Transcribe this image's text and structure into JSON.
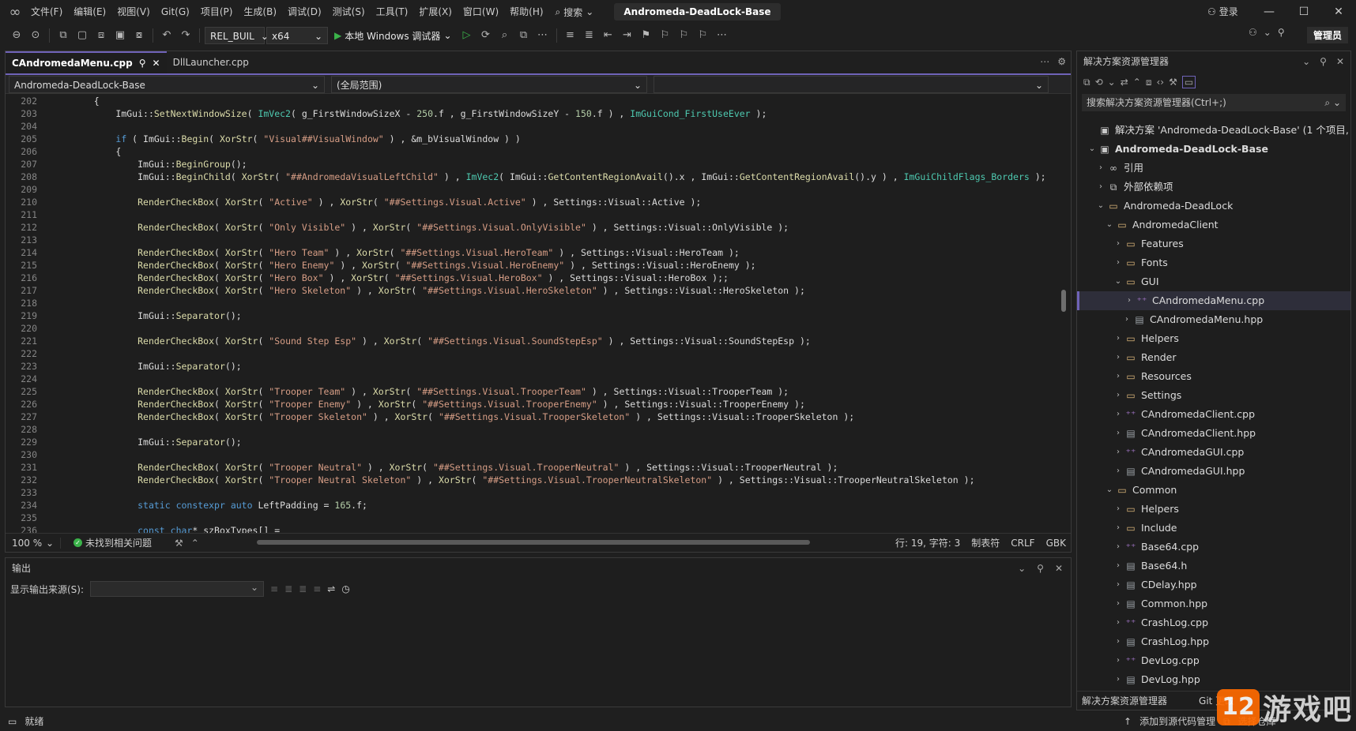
{
  "menubar": {
    "items": [
      "文件(F)",
      "编辑(E)",
      "视图(V)",
      "Git(G)",
      "项目(P)",
      "生成(B)",
      "调试(D)",
      "测试(S)",
      "工具(T)",
      "扩展(X)",
      "窗口(W)",
      "帮助(H)"
    ],
    "search_label": "搜索",
    "solution_name": "Andromeda-DeadLock-Base",
    "login_label": "登录"
  },
  "toolbar": {
    "config": "REL_BUIL",
    "platform": "x64",
    "run_label": "本地 Windows 调试器",
    "admin_label": "管理员"
  },
  "editor": {
    "tabs": [
      {
        "label": "CAndromedaMenu.cpp"
      },
      {
        "label": "DllLauncher.cpp"
      }
    ],
    "nav_project": "Andromeda-DeadLock-Base",
    "nav_scope": "(全局范围)",
    "zoom": "100 %",
    "issues": "未找到相关问题",
    "position": "行: 19, 字符: 3",
    "indent": "制表符",
    "line_ending": "CRLF",
    "encoding": "GBK",
    "lines": [
      {
        "n": "202",
        "c": "    {"
      },
      {
        "n": "203",
        "c": "        ImGui::SetNextWindowSize( ImVec2( g_FirstWindowSizeX - 250.f , g_FirstWindowSizeY - 150.f ) , ImGuiCond_FirstUseEver );"
      },
      {
        "n": "204",
        "c": ""
      },
      {
        "n": "205",
        "c": "        if ( ImGui::Begin( XorStr( \"Visual##VisualWindow\" ) , &m_bVisualWindow ) )"
      },
      {
        "n": "206",
        "c": "        {"
      },
      {
        "n": "207",
        "c": "            ImGui::BeginGroup();"
      },
      {
        "n": "208",
        "c": "            ImGui::BeginChild( XorStr( \"##AndromedaVisualLeftChild\" ) , ImVec2( ImGui::GetContentRegionAvail().x , ImGui::GetContentRegionAvail().y ) , ImGuiChildFlags_Borders );"
      },
      {
        "n": "209",
        "c": ""
      },
      {
        "n": "210",
        "c": "            RenderCheckBox( XorStr( \"Active\" ) , XorStr( \"##Settings.Visual.Active\" ) , Settings::Visual::Active );"
      },
      {
        "n": "211",
        "c": ""
      },
      {
        "n": "212",
        "c": "            RenderCheckBox( XorStr( \"Only Visible\" ) , XorStr( \"##Settings.Visual.OnlyVisible\" ) , Settings::Visual::OnlyVisible );"
      },
      {
        "n": "213",
        "c": ""
      },
      {
        "n": "214",
        "c": "            RenderCheckBox( XorStr( \"Hero Team\" ) , XorStr( \"##Settings.Visual.HeroTeam\" ) , Settings::Visual::HeroTeam );"
      },
      {
        "n": "215",
        "c": "            RenderCheckBox( XorStr( \"Hero Enemy\" ) , XorStr( \"##Settings.Visual.HeroEnemy\" ) , Settings::Visual::HeroEnemy );"
      },
      {
        "n": "216",
        "c": "            RenderCheckBox( XorStr( \"Hero Box\" ) , XorStr( \"##Settings.Visual.HeroBox\" ) , Settings::Visual::HeroBox );;"
      },
      {
        "n": "217",
        "c": "            RenderCheckBox( XorStr( \"Hero Skeleton\" ) , XorStr( \"##Settings.Visual.HeroSkeleton\" ) , Settings::Visual::HeroSkeleton );"
      },
      {
        "n": "218",
        "c": ""
      },
      {
        "n": "219",
        "c": "            ImGui::Separator();"
      },
      {
        "n": "220",
        "c": ""
      },
      {
        "n": "221",
        "c": "            RenderCheckBox( XorStr( \"Sound Step Esp\" ) , XorStr( \"##Settings.Visual.SoundStepEsp\" ) , Settings::Visual::SoundStepEsp );"
      },
      {
        "n": "222",
        "c": ""
      },
      {
        "n": "223",
        "c": "            ImGui::Separator();"
      },
      {
        "n": "224",
        "c": ""
      },
      {
        "n": "225",
        "c": "            RenderCheckBox( XorStr( \"Trooper Team\" ) , XorStr( \"##Settings.Visual.TrooperTeam\" ) , Settings::Visual::TrooperTeam );"
      },
      {
        "n": "226",
        "c": "            RenderCheckBox( XorStr( \"Trooper Enemy\" ) , XorStr( \"##Settings.Visual.TrooperEnemy\" ) , Settings::Visual::TrooperEnemy );"
      },
      {
        "n": "227",
        "c": "            RenderCheckBox( XorStr( \"Trooper Skeleton\" ) , XorStr( \"##Settings.Visual.TrooperSkeleton\" ) , Settings::Visual::TrooperSkeleton );"
      },
      {
        "n": "228",
        "c": ""
      },
      {
        "n": "229",
        "c": "            ImGui::Separator();"
      },
      {
        "n": "230",
        "c": ""
      },
      {
        "n": "231",
        "c": "            RenderCheckBox( XorStr( \"Trooper Neutral\" ) , XorStr( \"##Settings.Visual.TrooperNeutral\" ) , Settings::Visual::TrooperNeutral );"
      },
      {
        "n": "232",
        "c": "            RenderCheckBox( XorStr( \"Trooper Neutral Skeleton\" ) , XorStr( \"##Settings.Visual.TrooperNeutralSkeleton\" ) , Settings::Visual::TrooperNeutralSkeleton );"
      },
      {
        "n": "233",
        "c": ""
      },
      {
        "n": "234",
        "c": "            static constexpr auto LeftPadding = 165.f;"
      },
      {
        "n": "235",
        "c": ""
      },
      {
        "n": "236",
        "c": "            const char* szBoxTypes[] ="
      }
    ]
  },
  "output": {
    "title": "输出",
    "source_label": "显示输出来源(S):"
  },
  "solution": {
    "title": "解决方案资源管理器",
    "search_placeholder": "搜索解决方案资源管理器(Ctrl+;)",
    "footer_tab1": "解决方案资源管理器",
    "footer_tab2": "Git 更改",
    "tree": [
      {
        "label": "解决方案 'Andromeda-DeadLock-Base' (1 个项目,",
        "level": 0,
        "icon": "solution-icon",
        "caret": ""
      },
      {
        "label": "Andromeda-DeadLock-Base",
        "level": 0,
        "icon": "project-icon",
        "caret": "v",
        "bold": true
      },
      {
        "label": "引用",
        "level": 1,
        "icon": "references-icon",
        "caret": ">"
      },
      {
        "label": "外部依赖项",
        "level": 1,
        "icon": "external-deps-icon",
        "caret": ">"
      },
      {
        "label": "Andromeda-DeadLock",
        "level": 1,
        "icon": "folder-icon",
        "caret": "v"
      },
      {
        "label": "AndromedaClient",
        "level": 2,
        "icon": "folder-icon",
        "caret": "v"
      },
      {
        "label": "Features",
        "level": 3,
        "icon": "folder-icon",
        "caret": ">"
      },
      {
        "label": "Fonts",
        "level": 3,
        "icon": "folder-icon",
        "caret": ">"
      },
      {
        "label": "GUI",
        "level": 3,
        "icon": "folder-icon",
        "caret": "v"
      },
      {
        "label": "CAndromedaMenu.cpp",
        "level": 4,
        "icon": "cpp-file-icon",
        "caret": ">",
        "selected": true
      },
      {
        "label": "CAndromedaMenu.hpp",
        "level": 4,
        "icon": "header-file-icon",
        "caret": ">"
      },
      {
        "label": "Helpers",
        "level": 3,
        "icon": "folder-icon",
        "caret": ">"
      },
      {
        "label": "Render",
        "level": 3,
        "icon": "folder-icon",
        "caret": ">"
      },
      {
        "label": "Resources",
        "level": 3,
        "icon": "folder-icon",
        "caret": ">"
      },
      {
        "label": "Settings",
        "level": 3,
        "icon": "folder-icon",
        "caret": ">"
      },
      {
        "label": "CAndromedaClient.cpp",
        "level": 3,
        "icon": "cpp-file-icon",
        "caret": ">"
      },
      {
        "label": "CAndromedaClient.hpp",
        "level": 3,
        "icon": "header-file-icon",
        "caret": ">"
      },
      {
        "label": "CAndromedaGUI.cpp",
        "level": 3,
        "icon": "cpp-file-icon",
        "caret": ">"
      },
      {
        "label": "CAndromedaGUI.hpp",
        "level": 3,
        "icon": "header-file-icon",
        "caret": ">"
      },
      {
        "label": "Common",
        "level": 2,
        "icon": "folder-icon",
        "caret": "v"
      },
      {
        "label": "Helpers",
        "level": 3,
        "icon": "folder-icon",
        "caret": ">"
      },
      {
        "label": "Include",
        "level": 3,
        "icon": "folder-icon",
        "caret": ">"
      },
      {
        "label": "Base64.cpp",
        "level": 3,
        "icon": "cpp-file-icon",
        "caret": ">"
      },
      {
        "label": "Base64.h",
        "level": 3,
        "icon": "header-file-icon",
        "caret": ">"
      },
      {
        "label": "CDelay.hpp",
        "level": 3,
        "icon": "header-file-icon",
        "caret": ">"
      },
      {
        "label": "Common.hpp",
        "level": 3,
        "icon": "header-file-icon",
        "caret": ">"
      },
      {
        "label": "CrashLog.cpp",
        "level": 3,
        "icon": "cpp-file-icon",
        "caret": ">"
      },
      {
        "label": "CrashLog.hpp",
        "level": 3,
        "icon": "header-file-icon",
        "caret": ">"
      },
      {
        "label": "DevLog.cpp",
        "level": 3,
        "icon": "cpp-file-icon",
        "caret": ">"
      },
      {
        "label": "DevLog.hpp",
        "level": 3,
        "icon": "header-file-icon",
        "caret": ">"
      }
    ]
  },
  "statusbar": {
    "ready": "就绪",
    "add_source_control": "添加到源代码管理",
    "select_repo": "选择仓库"
  },
  "watermark": {
    "logo_text": "12",
    "site_text": "游戏吧"
  },
  "colors": {
    "accent": "#6f63b8",
    "background": "#1f1f1f",
    "editor_bg": "#1e1e1e",
    "run_green": "#3bb34a"
  }
}
